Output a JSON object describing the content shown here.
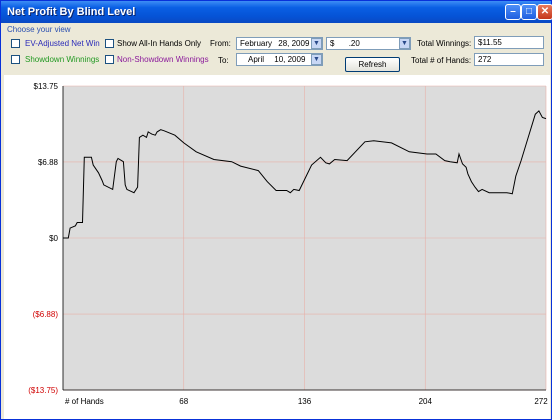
{
  "window": {
    "title": "Net Profit By Blind Level"
  },
  "controls": {
    "section_label": "Choose your view",
    "ev_adjusted": "EV-Adjusted Net Win",
    "showdown": "Showdown Winnings",
    "all_in_only": "Show All-In Hands Only",
    "non_showdown": "Non-Showdown Winnings",
    "from_label": "From:",
    "to_label": "To:",
    "from_month": "February",
    "from_day": "28, 2009",
    "to_month": "April",
    "to_day": "10, 2009",
    "blind_symbol": "$",
    "blind_value": ".20",
    "refresh_label": "Refresh",
    "total_winnings_label": "Total Winnings:",
    "total_winnings_value": "$11.55",
    "total_hands_label": "Total # of Hands:",
    "total_hands_value": "272"
  },
  "colors": {
    "ev_adjusted": "#2a2ab8",
    "showdown": "#229922",
    "non_showdown": "#8b1a9b",
    "negative": "#d00000",
    "grid": "#e8b0a8",
    "plot_bg": "#dcdcdc",
    "line": "#000000"
  },
  "chart_data": {
    "type": "line",
    "xlabel": "# of Hands",
    "x_ticks": [
      68,
      136,
      204,
      272
    ],
    "y_ticks": [
      "$13.75",
      "$6.88",
      "$0",
      "($6.88)",
      "($13.75)"
    ],
    "y_tick_values": [
      13.75,
      6.88,
      0,
      -6.88,
      -13.75
    ],
    "xlim": [
      0,
      272
    ],
    "ylim": [
      -13.75,
      13.75
    ],
    "grid": true,
    "series": [
      {
        "x": [
          0,
          3,
          4,
          7,
          8,
          11,
          12,
          13,
          16,
          17,
          20,
          22,
          23,
          28,
          30,
          31,
          34,
          35,
          36,
          40,
          42,
          43,
          45,
          47,
          48,
          49,
          50,
          52,
          53,
          55,
          57,
          63,
          68,
          75,
          85,
          95,
          100,
          110,
          115,
          120,
          126,
          128,
          130,
          133,
          140,
          145,
          148,
          150,
          153,
          160,
          170,
          175,
          185,
          195,
          205,
          210,
          215,
          218,
          222,
          223,
          225,
          227,
          228,
          230,
          232,
          234,
          236,
          240,
          245,
          250,
          253,
          255,
          258,
          262,
          266,
          268,
          270,
          272
        ],
        "y": [
          0,
          0,
          0.9,
          1.1,
          1.4,
          1.4,
          7.3,
          7.3,
          7.3,
          6.6,
          5.9,
          5.2,
          4.8,
          4.4,
          6.9,
          7.2,
          6.9,
          4.8,
          4.4,
          4.1,
          4.6,
          9.1,
          9.3,
          9.1,
          9.6,
          9.5,
          9.4,
          9.3,
          9.6,
          9.8,
          9.7,
          9.3,
          8.6,
          7.8,
          7.1,
          6.9,
          6.5,
          6.1,
          5.1,
          4.3,
          4.3,
          4.1,
          4.4,
          4.3,
          6.6,
          7.3,
          6.8,
          6.7,
          7.1,
          7.0,
          8.7,
          8.8,
          8.6,
          7.8,
          7.6,
          7.6,
          7.0,
          6.9,
          6.8,
          7.6,
          6.7,
          6.4,
          5.8,
          5.1,
          4.6,
          4.2,
          4.4,
          4.1,
          4.1,
          4.1,
          4.0,
          5.6,
          7.0,
          9.1,
          11.2,
          11.5,
          10.9,
          10.8
        ]
      }
    ]
  }
}
